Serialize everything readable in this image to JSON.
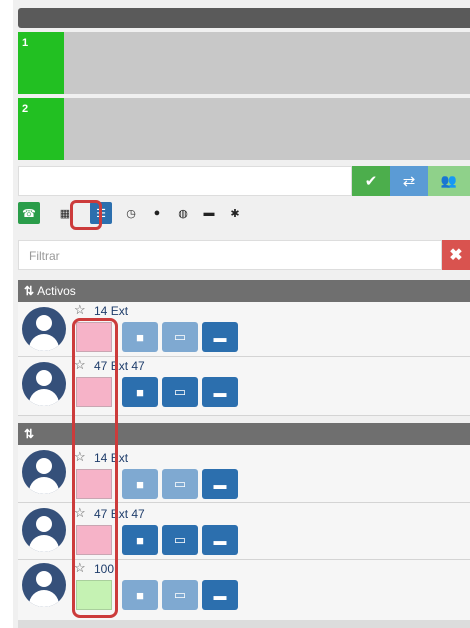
{
  "lines": [
    {
      "number": "1",
      "color": "#22c022"
    },
    {
      "number": "2",
      "color": "#22c022"
    }
  ],
  "dial": {
    "value": "",
    "buttons": [
      {
        "icon": "check-icon",
        "glyph": "✔",
        "color": "#4cae4c"
      },
      {
        "icon": "transfer-icon",
        "glyph": "⇄",
        "color": "#5b9bd5"
      },
      {
        "icon": "conference-icon",
        "glyph": "👥",
        "color": "#8fd18a"
      }
    ]
  },
  "tabs": [
    {
      "icon": "phone-icon",
      "glyph": "☎",
      "state": "on"
    },
    {
      "icon": "keypad-icon",
      "glyph": "▦",
      "state": ""
    },
    {
      "icon": "contacts-list-icon",
      "glyph": "☰",
      "state": "sel"
    },
    {
      "icon": "clock-icon",
      "glyph": "◷",
      "state": ""
    },
    {
      "icon": "user-icon",
      "glyph": "●",
      "state": ""
    },
    {
      "icon": "globe-icon",
      "glyph": "◍",
      "state": ""
    },
    {
      "icon": "chat-icon",
      "glyph": "▬",
      "state": ""
    },
    {
      "icon": "gear-icon",
      "glyph": "✱",
      "state": ""
    }
  ],
  "filter": {
    "placeholder": "Filtrar",
    "clear_glyph": "✖"
  },
  "groups": [
    {
      "sort_glyph": "⇅",
      "title": "Activos"
    },
    {
      "sort_glyph": "⇅",
      "title": ""
    }
  ],
  "contacts": [
    {
      "id": "14",
      "name": "Ext",
      "presence": "#f6b3c8",
      "video_active": false,
      "screen_active": false
    },
    {
      "id": "47",
      "name": "Ext 47",
      "presence": "#f6b3c8",
      "video_active": true,
      "screen_active": true
    },
    {
      "id": "14",
      "name": "Ext",
      "presence": "#f6b3c8",
      "video_active": false,
      "screen_active": false
    },
    {
      "id": "47",
      "name": "Ext 47",
      "presence": "#f6b3c8",
      "video_active": true,
      "screen_active": true
    },
    {
      "id": "100",
      "name": "",
      "presence": "#c5f2b3",
      "video_active": false,
      "screen_active": false
    }
  ],
  "star_glyph": "☆",
  "action_glyphs": {
    "video": "■",
    "screen": "▭",
    "chat": "▬"
  },
  "colors": {
    "action_active": "#2c6fae",
    "action_inactive": "#7fa9d1",
    "highlight": "#cc3b3b"
  }
}
